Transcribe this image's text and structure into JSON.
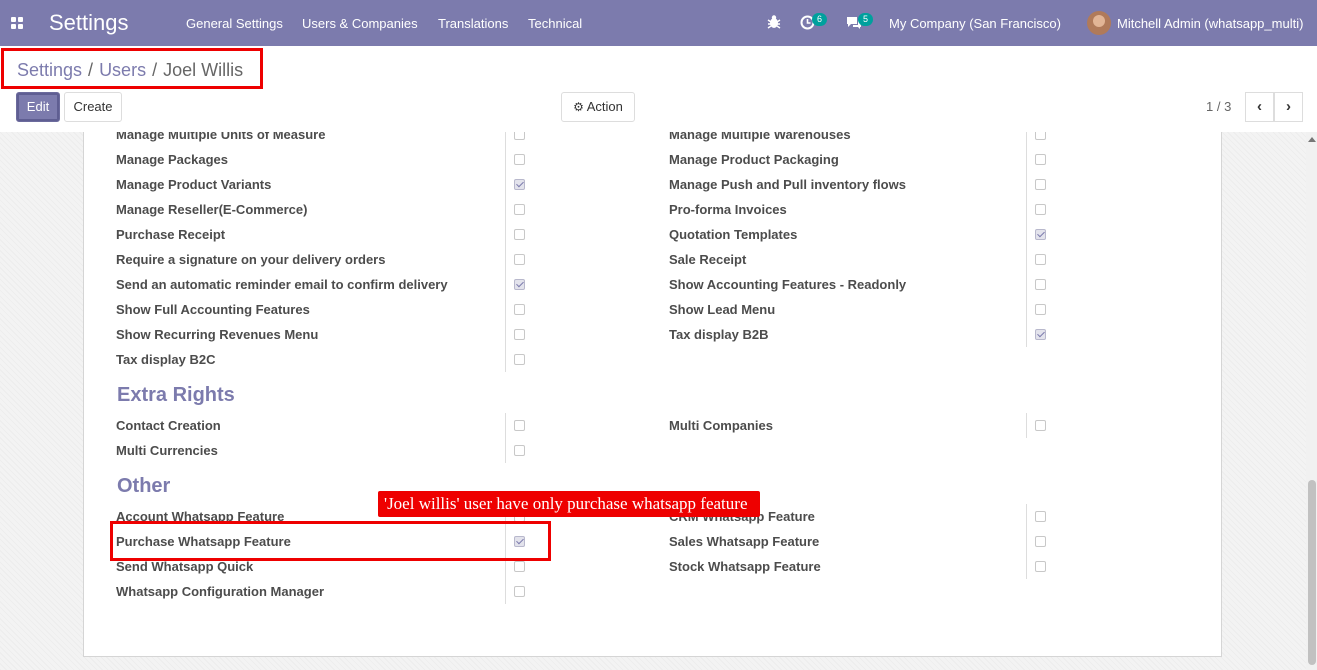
{
  "navbar": {
    "app_title": "Settings",
    "menu": [
      "General Settings",
      "Users & Companies",
      "Translations",
      "Technical"
    ],
    "activity_count": "6",
    "messages_count": "5",
    "company": "My Company (San Francisco)",
    "user": "Mitchell Admin (whatsapp_multi)"
  },
  "breadcrumb": {
    "root": "Settings",
    "parent": "Users",
    "current": "Joel Willis",
    "sep": "/"
  },
  "actions": {
    "edit": "Edit",
    "create": "Create",
    "action": "Action"
  },
  "pager": {
    "value": "1 / 3",
    "prev": "‹",
    "next": "›"
  },
  "rights_top": {
    "left": [
      {
        "label": "Manage Multiple Units of Measure",
        "checked": false
      },
      {
        "label": "Manage Packages",
        "checked": false
      },
      {
        "label": "Manage Product Variants",
        "checked": true
      },
      {
        "label": "Manage Reseller(E-Commerce)",
        "checked": false
      },
      {
        "label": "Purchase Receipt",
        "checked": false
      },
      {
        "label": "Require a signature on your delivery orders",
        "checked": false
      },
      {
        "label": "Send an automatic reminder email to confirm delivery",
        "checked": true
      },
      {
        "label": "Show Full Accounting Features",
        "checked": false
      },
      {
        "label": "Show Recurring Revenues Menu",
        "checked": false
      },
      {
        "label": "Tax display B2C",
        "checked": false
      }
    ],
    "right": [
      {
        "label": "Manage Multiple Warehouses",
        "checked": false
      },
      {
        "label": "Manage Product Packaging",
        "checked": false
      },
      {
        "label": "Manage Push and Pull inventory flows",
        "checked": false
      },
      {
        "label": "Pro-forma Invoices",
        "checked": false
      },
      {
        "label": "Quotation Templates",
        "checked": true
      },
      {
        "label": "Sale Receipt",
        "checked": false
      },
      {
        "label": "Show Accounting Features - Readonly",
        "checked": false
      },
      {
        "label": "Show Lead Menu",
        "checked": false
      },
      {
        "label": "Tax display B2B",
        "checked": true
      }
    ]
  },
  "extra_rights": {
    "title": "Extra Rights",
    "left": [
      {
        "label": "Contact Creation",
        "checked": false
      },
      {
        "label": "Multi Currencies",
        "checked": false
      }
    ],
    "right": [
      {
        "label": "Multi Companies",
        "checked": false
      }
    ]
  },
  "other": {
    "title": "Other",
    "left": [
      {
        "label": "Account Whatsapp Feature",
        "checked": false
      },
      {
        "label": "Purchase Whatsapp Feature",
        "checked": true
      },
      {
        "label": "Send Whatsapp Quick",
        "checked": false
      },
      {
        "label": "Whatsapp Configuration Manager",
        "checked": false
      }
    ],
    "right": [
      {
        "label": "CRM Whatsapp Feature",
        "checked": false
      },
      {
        "label": "Sales Whatsapp Feature",
        "checked": false
      },
      {
        "label": "Stock Whatsapp Feature",
        "checked": false
      }
    ]
  },
  "annotation": {
    "text": "'Joel willis' user have only purchase whatsapp feature",
    "color": "#ee0000"
  },
  "colors": {
    "brand": "#7c7bad",
    "badge": "#00a09d"
  }
}
